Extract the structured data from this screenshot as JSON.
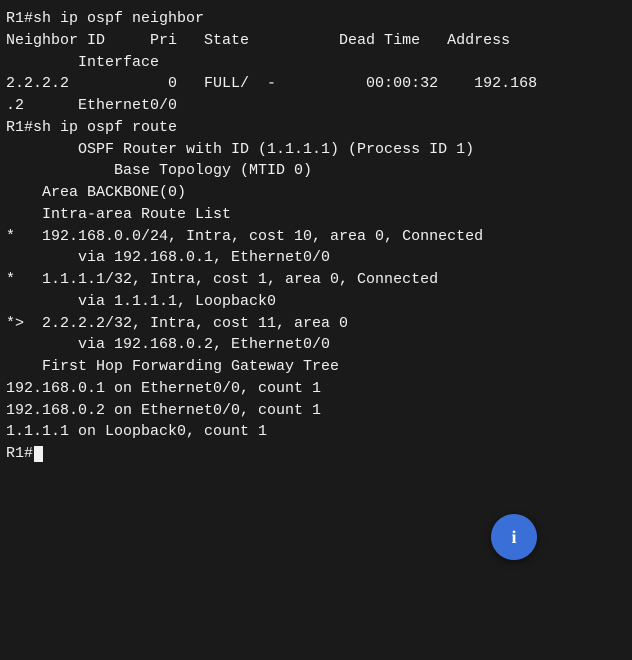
{
  "terminal": {
    "lines": [
      {
        "id": "cmd1",
        "text": "R1#sh ip ospf neighbor",
        "type": "command"
      },
      {
        "id": "header1",
        "text": "Neighbor ID     Pri   State          Dead Time   Address",
        "type": "header"
      },
      {
        "id": "header2",
        "text": "        Interface",
        "type": "header"
      },
      {
        "id": "neighbor1a",
        "text": "2.2.2.2           0   FULL/  -          00:00:32    192.168",
        "type": "data"
      },
      {
        "id": "neighbor1b",
        "text": ".2      Ethernet0/0",
        "type": "data"
      },
      {
        "id": "cmd2",
        "text": "R1#sh ip ospf route",
        "type": "command"
      },
      {
        "id": "blank1",
        "text": "",
        "type": "blank"
      },
      {
        "id": "ospf_id",
        "text": "        OSPF Router with ID (1.1.1.1) (Process ID 1)",
        "type": "data"
      },
      {
        "id": "blank2",
        "text": "",
        "type": "blank"
      },
      {
        "id": "base_topo",
        "text": "            Base Topology (MTID 0)",
        "type": "data"
      },
      {
        "id": "blank3",
        "text": "",
        "type": "blank"
      },
      {
        "id": "area",
        "text": "    Area BACKBONE(0)",
        "type": "data"
      },
      {
        "id": "blank4",
        "text": "",
        "type": "blank"
      },
      {
        "id": "intra",
        "text": "    Intra-area Route List",
        "type": "data"
      },
      {
        "id": "blank5",
        "text": "",
        "type": "blank"
      },
      {
        "id": "route1a",
        "text": "*   192.168.0.0/24, Intra, cost 10, area 0, Connected",
        "type": "data"
      },
      {
        "id": "route1b",
        "text": "        via 192.168.0.1, Ethernet0/0",
        "type": "data"
      },
      {
        "id": "route2a",
        "text": "*   1.1.1.1/32, Intra, cost 1, area 0, Connected",
        "type": "data"
      },
      {
        "id": "route2b",
        "text": "        via 1.1.1.1, Loopback0",
        "type": "data"
      },
      {
        "id": "route3a",
        "text": "*>  2.2.2.2/32, Intra, cost 11, area 0",
        "type": "data"
      },
      {
        "id": "route3b",
        "text": "        via 192.168.0.2, Ethernet0/0",
        "type": "data"
      },
      {
        "id": "blank6",
        "text": "",
        "type": "blank"
      },
      {
        "id": "fhfgt",
        "text": "    First Hop Forwarding Gateway Tree",
        "type": "data"
      },
      {
        "id": "blank7",
        "text": "",
        "type": "blank"
      },
      {
        "id": "fh1",
        "text": "192.168.0.1 on Ethernet0/0, count 1",
        "type": "data"
      },
      {
        "id": "fh2",
        "text": "192.168.0.2 on Ethernet0/0, count 1",
        "type": "data"
      },
      {
        "id": "fh3",
        "text": "1.1.1.1 on Loopback0, count 1",
        "type": "data"
      },
      {
        "id": "prompt",
        "text": "R1#",
        "type": "prompt"
      }
    ],
    "fab": {
      "label": "i"
    }
  }
}
